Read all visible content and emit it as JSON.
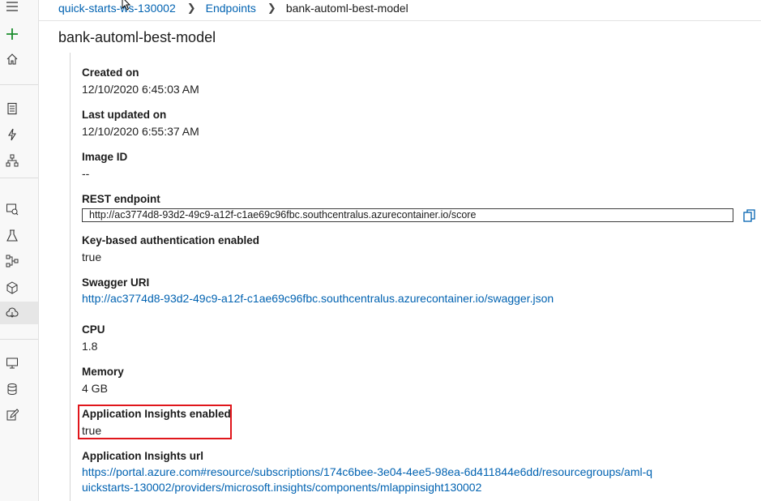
{
  "breadcrumb": {
    "workspace": "quick-starts-ws-130002",
    "section": "Endpoints",
    "current": "bank-automl-best-model"
  },
  "page": {
    "title": "bank-automl-best-model"
  },
  "details": {
    "created_on_label": "Created on",
    "created_on_value": "12/10/2020 6:45:03 AM",
    "last_updated_label": "Last updated on",
    "last_updated_value": "12/10/2020 6:55:37 AM",
    "image_id_label": "Image ID",
    "image_id_value": "--",
    "rest_endpoint_label": "REST endpoint",
    "rest_endpoint_value": "http://ac3774d8-93d2-49c9-a12f-c1ae69c96fbc.southcentralus.azurecontainer.io/score",
    "key_auth_label": "Key-based authentication enabled",
    "key_auth_value": "true",
    "swagger_label": "Swagger URI",
    "swagger_value": "http://ac3774d8-93d2-49c9-a12f-c1ae69c96fbc.southcentralus.azurecontainer.io/swagger.json",
    "cpu_label": "CPU",
    "cpu_value": "1.8",
    "memory_label": "Memory",
    "memory_value": "4 GB",
    "app_insights_label": "Application Insights enabled",
    "app_insights_value": "true",
    "app_insights_url_label": "Application Insights url",
    "app_insights_url_line1": "https://portal.azure.com#resource/subscriptions/174c6bee-3e04-4ee5-98ea-6d411844e6dd/resourcegroups/aml-q",
    "app_insights_url_line2": "uickstarts-130002/providers/microsoft.insights/components/mlappinsight130002"
  },
  "sidebar_icons": [
    "menu-icon",
    "add-icon",
    "home-icon",
    "notebook-icon",
    "automl-icon",
    "designer-icon",
    "datasets-icon",
    "experiments-icon",
    "pipelines-icon",
    "models-icon",
    "endpoints-icon",
    "compute-icon",
    "datastores-icon",
    "labeling-icon"
  ],
  "colors": {
    "link": "#0062b1",
    "highlight": "#e0161b",
    "add_icon": "#1a8c2c"
  }
}
